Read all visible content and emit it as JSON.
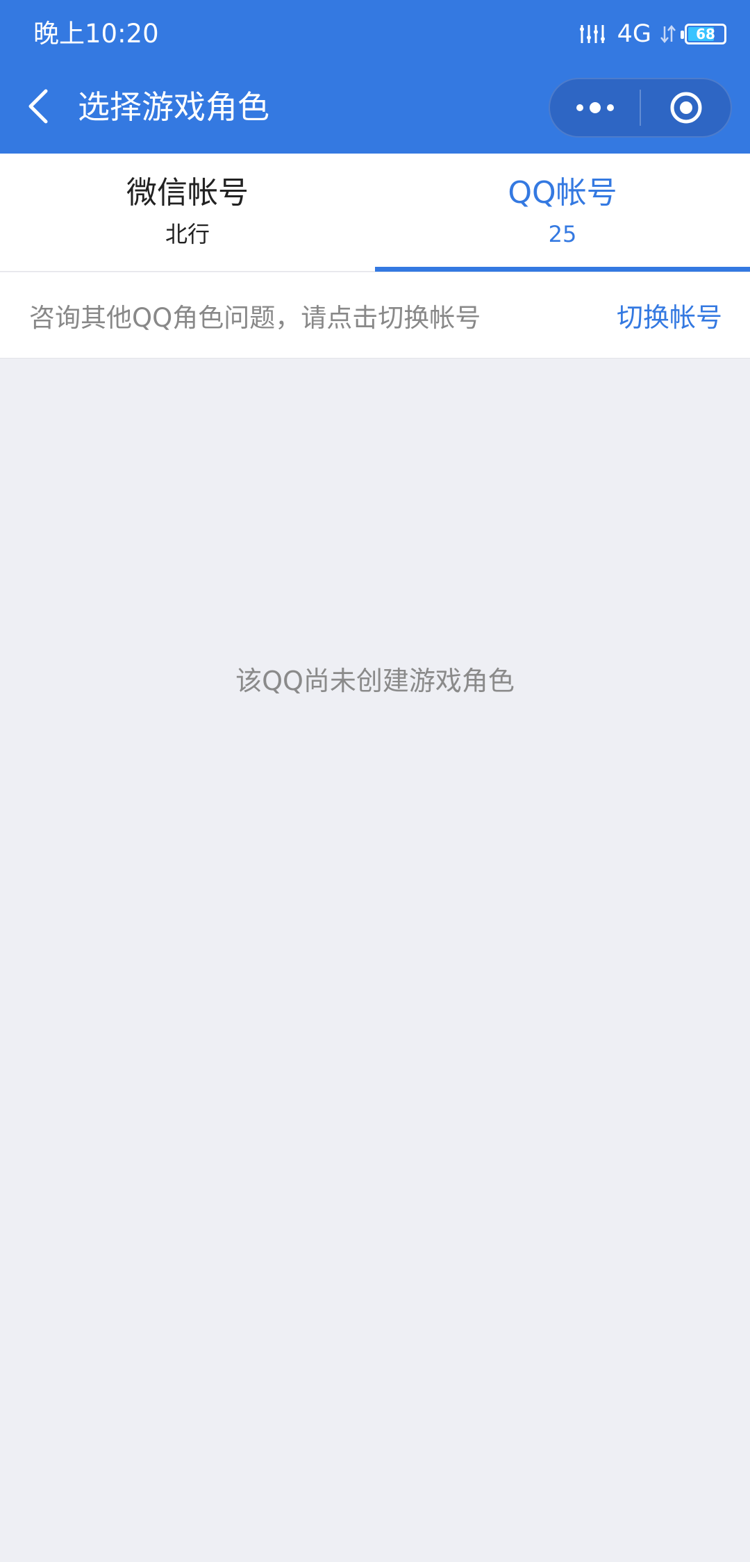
{
  "status_bar": {
    "time": "晚上10:20",
    "network": "4G",
    "battery": "68"
  },
  "nav": {
    "title": "选择游戏角色"
  },
  "tabs": [
    {
      "title": "微信帐号",
      "subtitle": "北行",
      "active": false
    },
    {
      "title": "QQ帐号",
      "subtitle": "25",
      "active": true
    }
  ],
  "info": {
    "text": "咨询其他QQ角色问题，请点击切换帐号",
    "link": "切换帐号"
  },
  "empty_state": {
    "text": "该QQ尚未创建游戏角色"
  },
  "colors": {
    "primary": "#3479e1",
    "background": "#eeeff4"
  }
}
